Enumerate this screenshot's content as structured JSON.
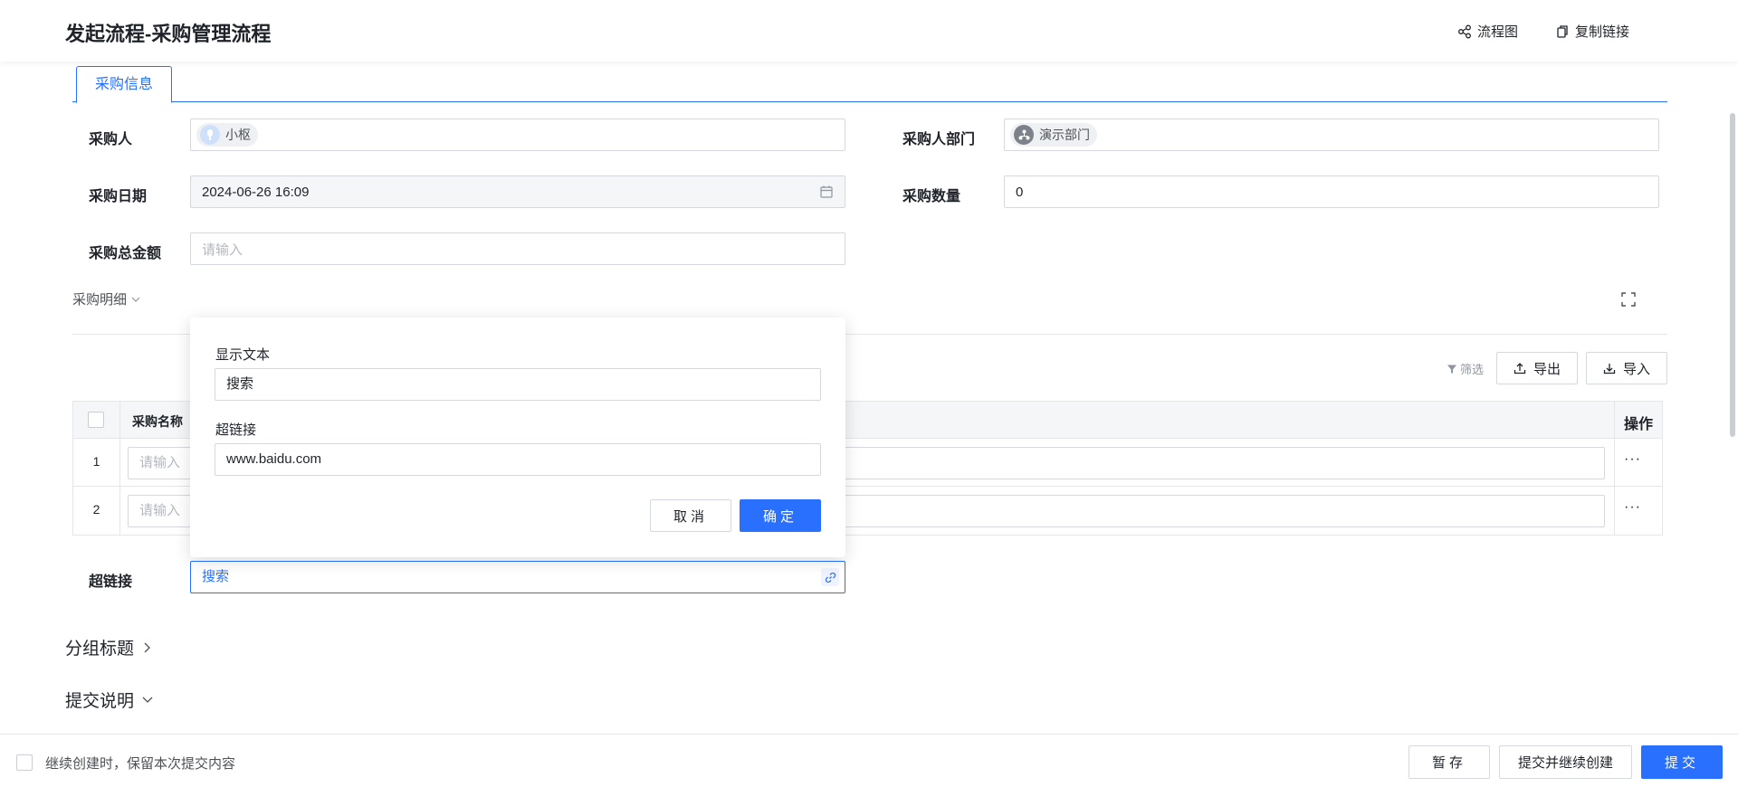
{
  "header": {
    "title": "发起流程-采购管理流程",
    "flow_chart_label": "流程图",
    "copy_link_label": "复制链接"
  },
  "tabs": [
    {
      "label": "采购信息",
      "active": true
    }
  ],
  "form": {
    "buyer_label": "采购人",
    "buyer_value": "小枢",
    "dept_label": "采购人部门",
    "dept_value": "演示部门",
    "date_label": "采购日期",
    "date_value": "2024-06-26 16:09",
    "quantity_label": "采购数量",
    "quantity_value": "0",
    "total_label": "采购总金额",
    "total_placeholder": "请输入"
  },
  "detail": {
    "section_label": "采购明细",
    "filter_label": "筛选",
    "export_label": "导出",
    "import_label": "导入",
    "columns": [
      "采购名称",
      "操作"
    ],
    "rows": [
      {
        "index": "1",
        "placeholder": "请输入",
        "more": "···"
      },
      {
        "index": "2",
        "placeholder": "请输入",
        "more": "···"
      }
    ]
  },
  "hyperlink": {
    "label": "超链接",
    "value": "搜索"
  },
  "popover": {
    "display_text_label": "显示文本",
    "display_text_value": "搜索",
    "link_label": "超链接",
    "link_value": "www.baidu.com",
    "cancel_label": "取消",
    "confirm_label": "确定"
  },
  "groups": {
    "group_title": "分组标题",
    "submit_notes": "提交说明"
  },
  "footer": {
    "keep_content_label": "继续创建时，保留本次提交内容",
    "save_draft_label": "暂存",
    "submit_continue_label": "提交并继续创建",
    "submit_label": "提交"
  },
  "colors": {
    "accent": "#2970ff",
    "border": "#d5d8de",
    "text": "#1f2329"
  },
  "icons": [
    "flow-chart-icon",
    "copy-icon",
    "calendar-icon",
    "expand-icon",
    "filter-icon",
    "export-icon",
    "import-icon",
    "link-icon",
    "chevron-down-icon",
    "chevron-right-icon"
  ]
}
